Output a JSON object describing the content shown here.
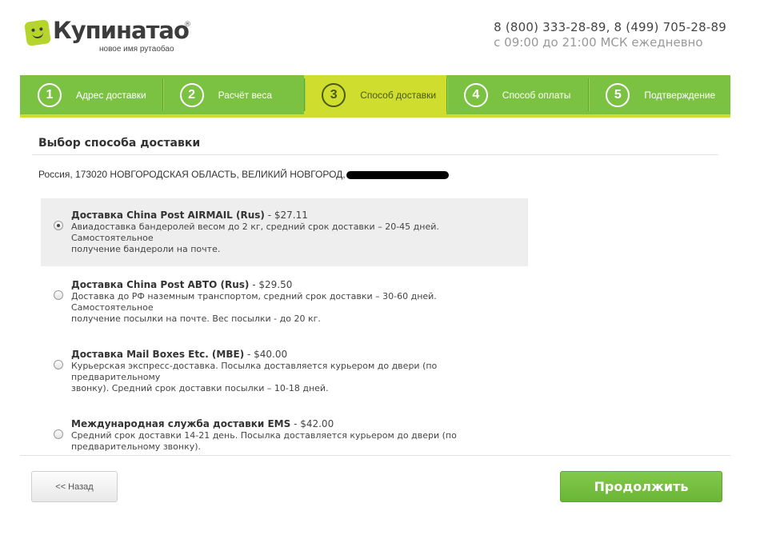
{
  "header": {
    "logo_text": "Купинатао",
    "logo_reg": "®",
    "logo_tagline": "новое имя рутаобао",
    "logo_icon": "smiley-logo-icon",
    "phones": "8 (800) 333-28-89, 8 (499) 705-28-89",
    "hours": "с 09:00 до 21:00 МСК ежедневно"
  },
  "steps": [
    {
      "num": "1",
      "label": "Адрес доставки",
      "active": false
    },
    {
      "num": "2",
      "label": "Расчёт веса",
      "active": false
    },
    {
      "num": "3",
      "label": "Способ доставки",
      "active": true
    },
    {
      "num": "4",
      "label": "Способ оплаты",
      "active": false
    },
    {
      "num": "5",
      "label": "Подтверждение",
      "active": false
    }
  ],
  "section_title": "Выбор способа доставки",
  "address": "Россия, 173020 НОВГОРОДСКАЯ ОБЛАСТЬ, ВЕЛИКИЙ НОВГОРОД,",
  "options": [
    {
      "name": "Доставка China Post AIRMAIL (Rus)",
      "price": " - $27.11",
      "desc_1": "Авиадоставка бандеролей весом до 2 кг, средний срок доставки – 20-45 дней. Самостоятельное",
      "desc_2": "получение бандероли на почте.",
      "selected": true
    },
    {
      "name": "Доставка China Post АВТО (Rus)",
      "price": " - $29.50",
      "desc_1": "Доставка до РФ наземным транспортом, средний срок доставки – 30-60 дней. Самостоятельное",
      "desc_2": "получение посылки на почте. Вес посылки - до 20 кг.",
      "selected": false
    },
    {
      "name": "Доставка Mail Boxes Etc. (MBE)",
      "price": " - $40.00",
      "desc_1": "Курьерская экспресс-доставка. Посылка доставляется курьером до двери (по предварительному",
      "desc_2": "звонку). Средний срок доставки посылки – 10-18 дней.",
      "selected": false
    },
    {
      "name": "Международная служба доставки EMS",
      "price": " - $42.00",
      "desc_1": "Средний срок доставки 14-21 день. Посылка доставляется курьером до двери (по",
      "desc_2": "предварительному звонку).",
      "selected": false
    }
  ],
  "buttons": {
    "back": "<< Назад",
    "next": "Продолжить"
  },
  "colors": {
    "brand_green": "#7cc242",
    "active_step": "#cfdd2f",
    "button_green": "#6ab536"
  }
}
